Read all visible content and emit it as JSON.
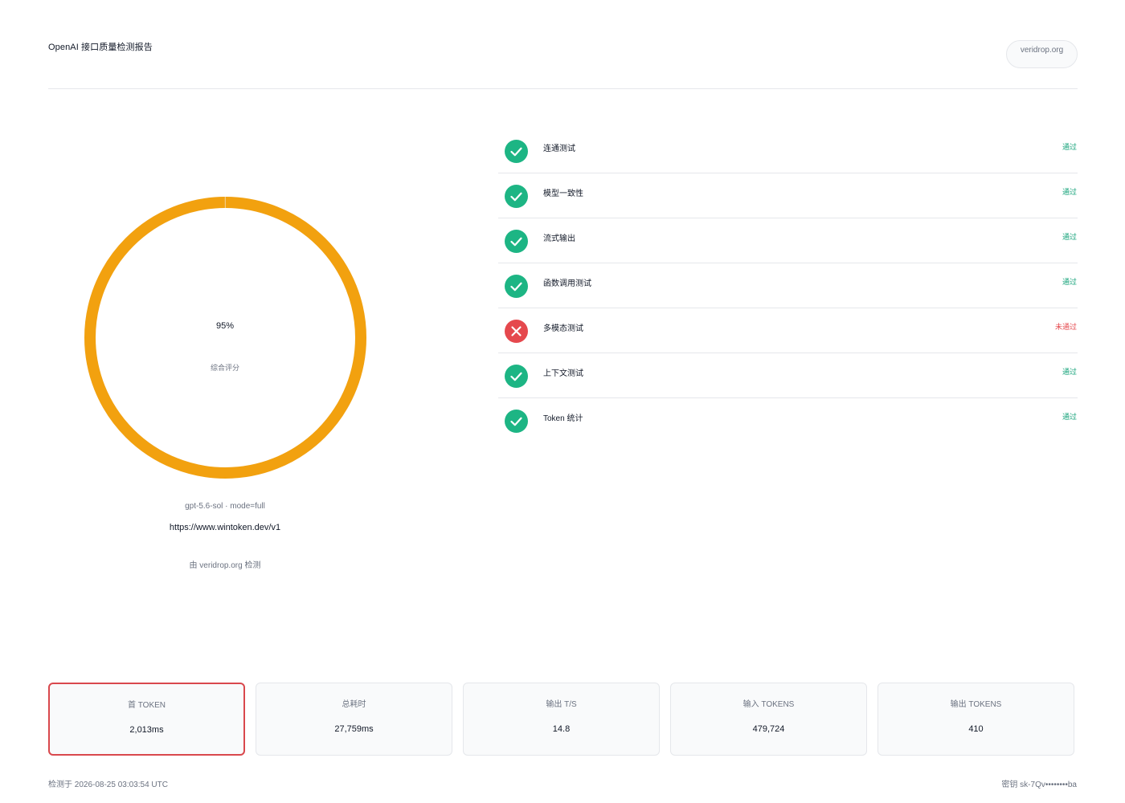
{
  "header": {
    "title": "OpenAI 接口质量检测报告",
    "domain": "veridrop.org"
  },
  "score": {
    "value": "95%",
    "fraction": 0.95,
    "label": "综合评分",
    "model_line": "gpt-5.6-sol · mode=full",
    "url": "https://www.wintoken.dev/v1",
    "source": "由 veridrop.org 检测",
    "ring_color": "#f2a10f"
  },
  "checks": [
    {
      "name": "连通测试",
      "status": "通过",
      "result": "pass"
    },
    {
      "name": "模型一致性",
      "status": "通过",
      "result": "pass"
    },
    {
      "name": "流式输出",
      "status": "通过",
      "result": "pass"
    },
    {
      "name": "函数调用测试",
      "status": "通过",
      "result": "pass"
    },
    {
      "name": "多模态测试",
      "status": "未通过",
      "result": "fail"
    },
    {
      "name": "上下文测试",
      "status": "通过",
      "result": "pass"
    },
    {
      "name": "Token 统计",
      "status": "通过",
      "result": "pass"
    }
  ],
  "metrics": [
    {
      "label": "首 TOKEN",
      "value": "2,013ms"
    },
    {
      "label": "总耗时",
      "value": "27,759ms"
    },
    {
      "label": "输出 T/S",
      "value": "14.8"
    },
    {
      "label": "输入 TOKENS",
      "value": "479,724"
    },
    {
      "label": "输出 TOKENS",
      "value": "410"
    }
  ],
  "footer": {
    "timestamp": "检测于 2026-08-25 03:03:54 UTC",
    "key": "密钥 sk-7Qv••••••••ba"
  },
  "colors": {
    "pass": "#1db584",
    "fail": "#e5484d",
    "ring": "#f2a10f"
  }
}
